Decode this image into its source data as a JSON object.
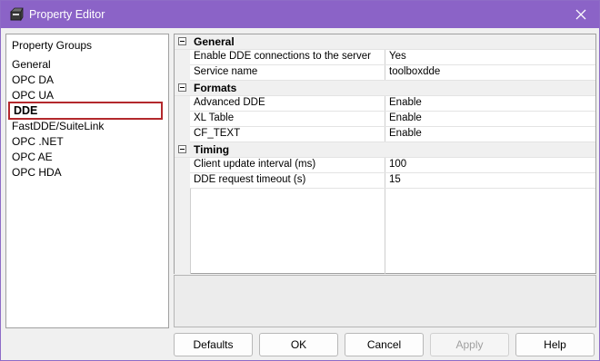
{
  "window": {
    "title": "Property Editor",
    "accent_color": "#8b63c7",
    "icon": "app-icon"
  },
  "groups": {
    "header": "Property Groups",
    "items": [
      "General",
      "OPC DA",
      "OPC UA",
      "DDE",
      "FastDDE/SuiteLink",
      "OPC .NET",
      "OPC AE",
      "OPC HDA"
    ],
    "selected": "DDE"
  },
  "grid": {
    "categories": [
      {
        "label": "General",
        "props": [
          {
            "name": "Enable DDE connections to the server",
            "value": "Yes"
          },
          {
            "name": "Service name",
            "value": "toolboxdde"
          }
        ]
      },
      {
        "label": "Formats",
        "props": [
          {
            "name": "Advanced DDE",
            "value": "Enable"
          },
          {
            "name": "XL Table",
            "value": "Enable"
          },
          {
            "name": "CF_TEXT",
            "value": "Enable"
          }
        ]
      },
      {
        "label": "Timing",
        "props": [
          {
            "name": "Client update interval (ms)",
            "value": "100"
          },
          {
            "name": "DDE request timeout (s)",
            "value": "15"
          }
        ]
      }
    ]
  },
  "buttons": {
    "defaults": "Defaults",
    "ok": "OK",
    "cancel": "Cancel",
    "apply": "Apply",
    "help": "Help"
  }
}
